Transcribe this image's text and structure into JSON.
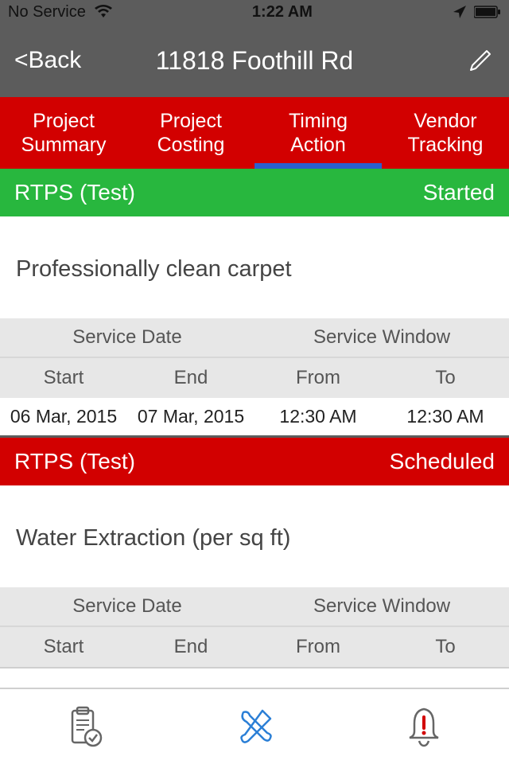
{
  "status": {
    "carrier": "No Service",
    "time": "1:22 AM"
  },
  "nav": {
    "back": "<Back",
    "title": "11818 Foothill Rd"
  },
  "tabs": {
    "items": [
      {
        "line1": "Project",
        "line2": "Summary"
      },
      {
        "line1": "Project",
        "line2": "Costing"
      },
      {
        "line1": "Timing",
        "line2": "Action"
      },
      {
        "line1": "Vendor",
        "line2": "Tracking"
      }
    ],
    "active_index": 2
  },
  "sections": [
    {
      "vendor": "RTPS (Test)",
      "status": "Started",
      "status_color": "green",
      "task": "Professionally clean carpet",
      "headers": {
        "service_date": "Service Date",
        "service_window": "Service Window",
        "start": "Start",
        "end": "End",
        "from": "From",
        "to": "To"
      },
      "data": {
        "start": "06 Mar, 2015",
        "end": "07 Mar, 2015",
        "from": "12:30 AM",
        "to": "12:30 AM"
      }
    },
    {
      "vendor": "RTPS (Test)",
      "status": "Scheduled",
      "status_color": "red",
      "task": "Water Extraction (per sq ft)",
      "headers": {
        "service_date": "Service Date",
        "service_window": "Service Window",
        "start": "Start",
        "end": "End",
        "from": "From",
        "to": "To"
      },
      "data": {
        "start": "",
        "end": "",
        "from": "",
        "to": ""
      }
    }
  ]
}
